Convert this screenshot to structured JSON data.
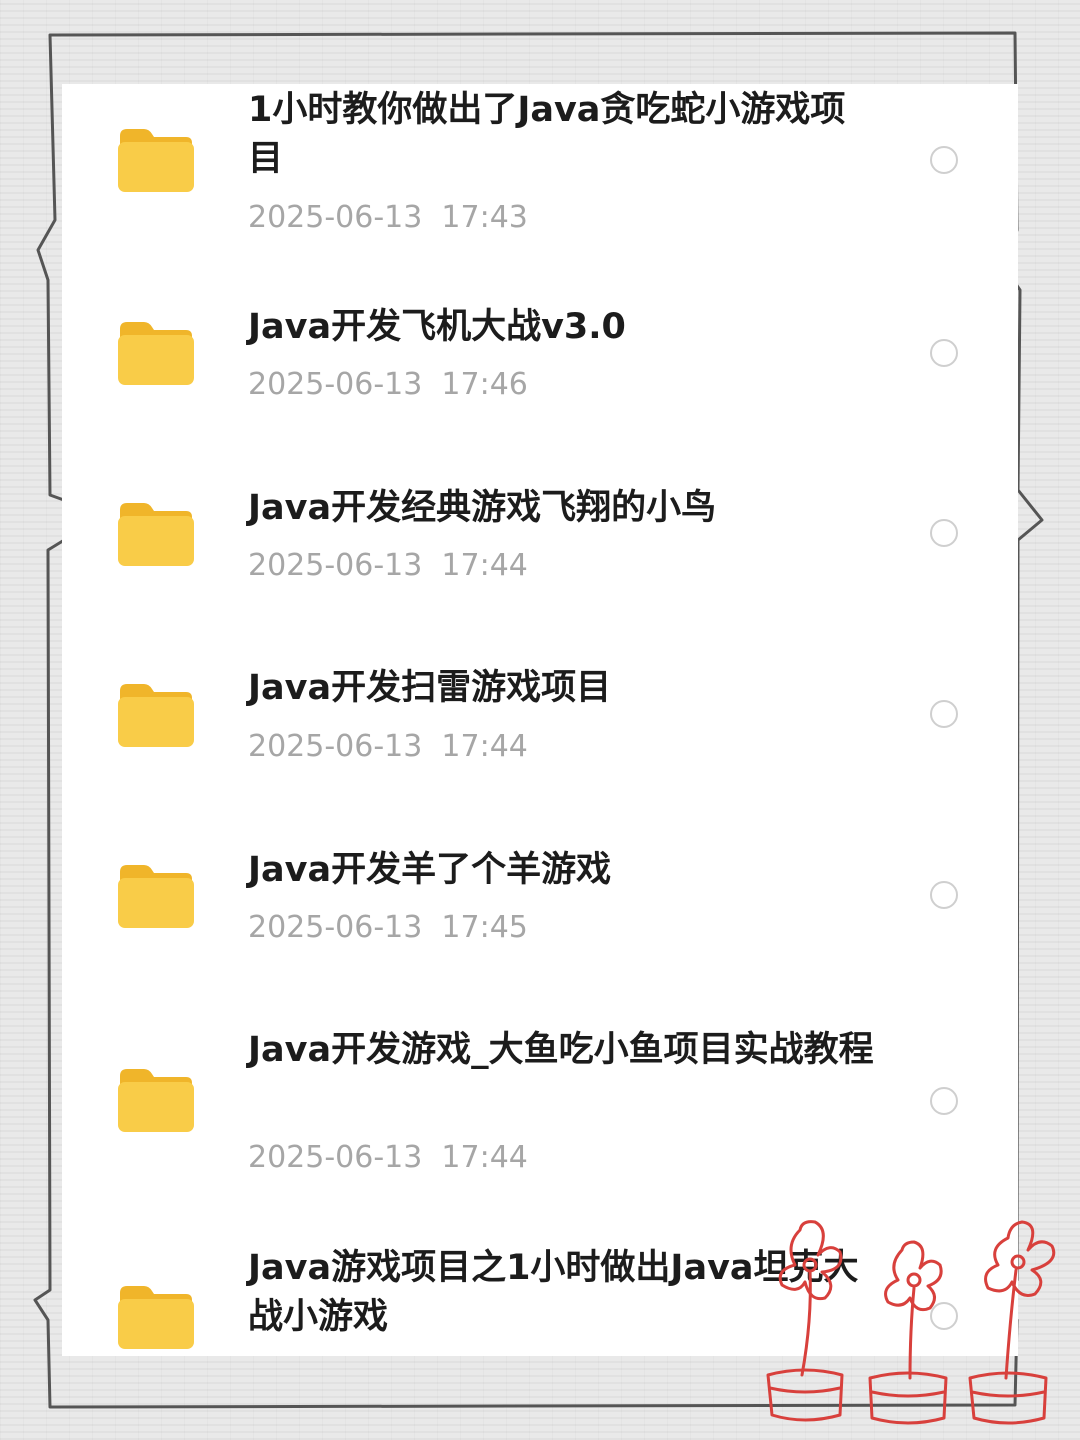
{
  "files": [
    {
      "title": "1小时教你做出了Java贪吃蛇小游戏项目",
      "time": "2025-06-13  17:43",
      "icon": "folder-icon"
    },
    {
      "title": "Java开发飞机大战v3.0",
      "time": "2025-06-13  17:46",
      "icon": "folder-icon"
    },
    {
      "title": "Java开发经典游戏飞翔的小鸟",
      "time": "2025-06-13  17:44",
      "icon": "folder-icon"
    },
    {
      "title": "Java开发扫雷游戏项目",
      "time": "2025-06-13  17:44",
      "icon": "folder-icon"
    },
    {
      "title": "Java开发羊了个羊游戏",
      "time": "2025-06-13  17:45",
      "icon": "folder-icon"
    },
    {
      "title": "Java开发游戏_大鱼吃小鱼项目实战教程",
      "time": "2025-06-13  17:44",
      "icon": "folder-icon"
    },
    {
      "title": "Java游戏项目之1小时做出Java坦克大战小游戏",
      "time": "",
      "icon": "folder-icon"
    }
  ],
  "colors": {
    "folder": "#f7c843",
    "folder_tab": "#f5b82e",
    "title_text": "#1c1c1c",
    "time_text": "#a6a6a6",
    "radio_border": "#cfcfcf",
    "doodle": "#d8403c"
  }
}
